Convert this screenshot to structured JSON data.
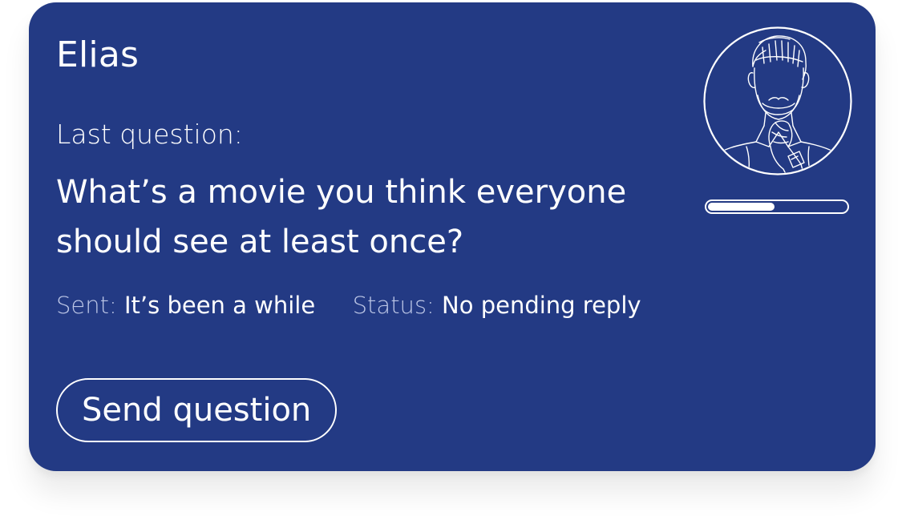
{
  "card": {
    "name": "Elias",
    "last_question_label": "Last question:",
    "question_text": "What’s a movie you think everyone should see at least once?",
    "sent_label": "Sent:",
    "sent_value": "It’s been a while",
    "status_label": "Status:",
    "status_value": "No pending reply",
    "send_button_label": "Send question",
    "avatar_icon": "thinking-man-portrait-icon",
    "progress_fraction": 0.47
  },
  "colors": {
    "card_background": "#233a84",
    "text": "#ffffff",
    "muted_label": "#bcc6e6"
  }
}
